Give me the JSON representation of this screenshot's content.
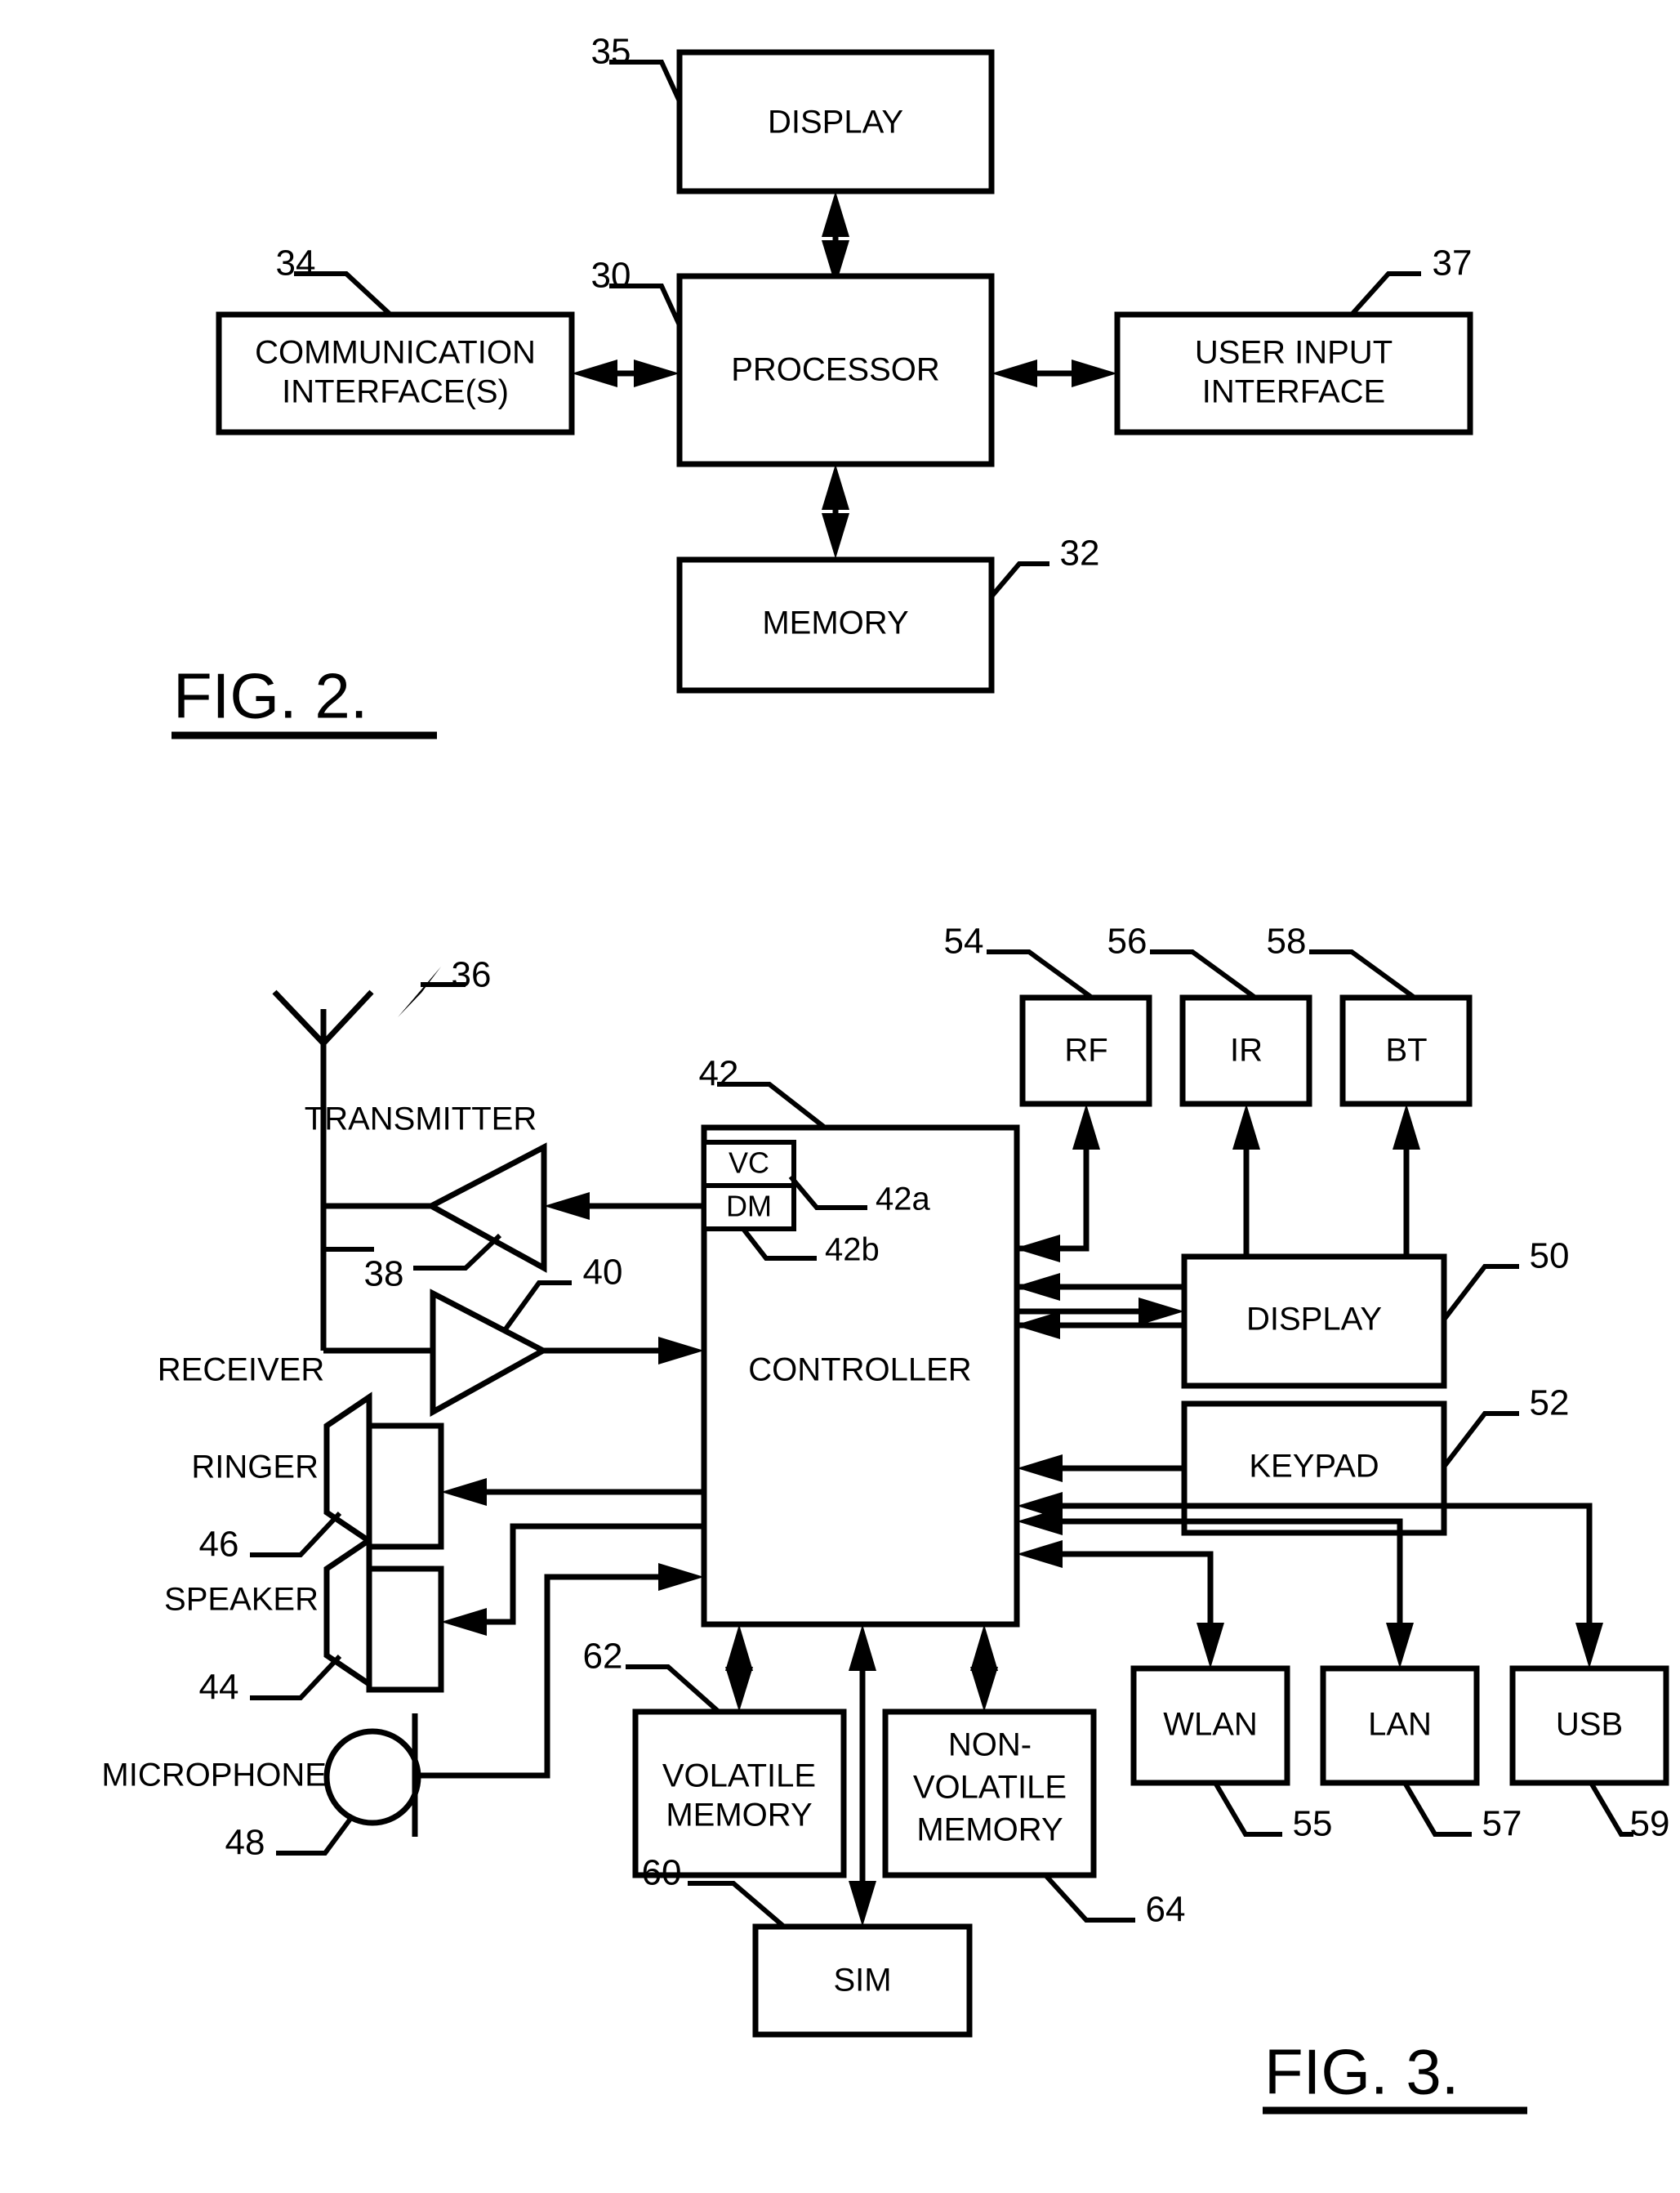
{
  "figures": [
    {
      "id": "fig2",
      "caption": "FIG. 2.",
      "blocks": [
        {
          "key": "display",
          "label": "DISPLAY",
          "ref": "35"
        },
        {
          "key": "processor",
          "label": "PROCESSOR",
          "ref": "30"
        },
        {
          "key": "comm",
          "label1": "COMMUNICATION",
          "label2": "INTERFACE(S)",
          "ref": "34"
        },
        {
          "key": "userinput",
          "label1": "USER INPUT",
          "label2": "INTERFACE",
          "ref": "37"
        },
        {
          "key": "memory",
          "label": "MEMORY",
          "ref": "32"
        }
      ]
    },
    {
      "id": "fig3",
      "caption": "FIG. 3.",
      "blocks": [
        {
          "key": "rf",
          "label": "RF",
          "ref": "54"
        },
        {
          "key": "ir",
          "label": "IR",
          "ref": "56"
        },
        {
          "key": "bt",
          "label": "BT",
          "ref": "58"
        },
        {
          "key": "controller",
          "label": "CONTROLLER",
          "ref": "42"
        },
        {
          "key": "vc",
          "label": "VC",
          "ref": "42a"
        },
        {
          "key": "dm",
          "label": "DM",
          "ref": "42b"
        },
        {
          "key": "display",
          "label": "DISPLAY",
          "ref": "50"
        },
        {
          "key": "keypad",
          "label": "KEYPAD",
          "ref": "52"
        },
        {
          "key": "wlan",
          "label": "WLAN",
          "ref": "55"
        },
        {
          "key": "lan",
          "label": "LAN",
          "ref": "57"
        },
        {
          "key": "usb",
          "label": "USB",
          "ref": "59"
        },
        {
          "key": "volatile",
          "label1": "VOLATILE",
          "label2": "MEMORY",
          "ref": "62"
        },
        {
          "key": "nonvolatile",
          "label1": "NON-",
          "label2": "VOLATILE",
          "label3": "MEMORY",
          "ref": "64"
        },
        {
          "key": "sim",
          "label": "SIM",
          "ref": "60"
        }
      ],
      "parts": [
        {
          "key": "antenna",
          "label": "",
          "ref": "36"
        },
        {
          "key": "transmitter",
          "label": "TRANSMITTER",
          "ref": "38"
        },
        {
          "key": "receiver",
          "label": "RECEIVER",
          "ref": "40"
        },
        {
          "key": "ringer",
          "label": "RINGER",
          "ref": "46"
        },
        {
          "key": "speaker",
          "label": "SPEAKER",
          "ref": "44"
        },
        {
          "key": "microphone",
          "label": "MICROPHONE",
          "ref": "48"
        }
      ]
    }
  ],
  "colors": {
    "ink": "#000000",
    "paper": "#ffffff"
  }
}
